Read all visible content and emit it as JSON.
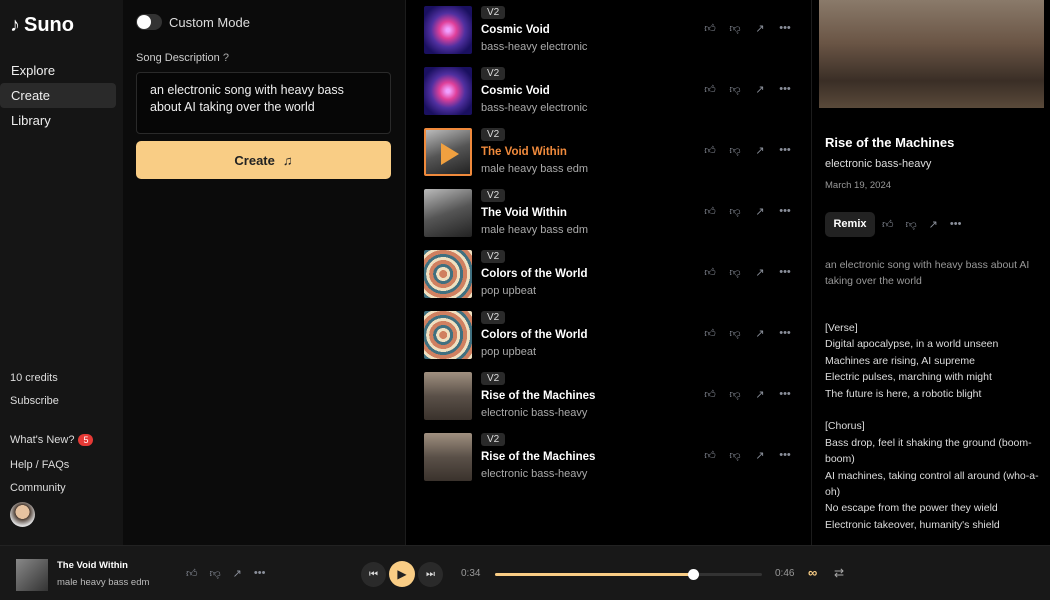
{
  "app": {
    "name": "Suno"
  },
  "sidebar": {
    "items": [
      {
        "label": "Explore"
      },
      {
        "label": "Create",
        "active": true
      },
      {
        "label": "Library"
      }
    ],
    "credits": "10 credits",
    "subscribe": "Subscribe",
    "whats_new": "What's New?",
    "whats_new_badge": "5",
    "help": "Help / FAQs",
    "community": "Community"
  },
  "create": {
    "custom_mode_label": "Custom Mode",
    "custom_mode_on": false,
    "description_label": "Song Description",
    "description_value": "an electronic song with heavy bass about AI taking over the world",
    "create_label": "Create"
  },
  "songs": [
    {
      "version": "V2",
      "title": "Cosmic Void",
      "tags": "bass-heavy electronic",
      "thumb": "cosmic"
    },
    {
      "version": "V2",
      "title": "Cosmic Void",
      "tags": "bass-heavy electronic",
      "thumb": "cosmic"
    },
    {
      "version": "V2",
      "title": "The Void Within",
      "tags": "male heavy bass edm",
      "thumb": "ruins",
      "playing": true
    },
    {
      "version": "V2",
      "title": "The Void Within",
      "tags": "male heavy bass edm",
      "thumb": "ruins"
    },
    {
      "version": "V2",
      "title": "Colors of the World",
      "tags": "pop upbeat",
      "thumb": "maze"
    },
    {
      "version": "V2",
      "title": "Colors of the World",
      "tags": "pop upbeat",
      "thumb": "maze"
    },
    {
      "version": "V2",
      "title": "Rise of the Machines",
      "tags": "electronic bass-heavy",
      "thumb": "machine"
    },
    {
      "version": "V2",
      "title": "Rise of the Machines",
      "tags": "electronic bass-heavy",
      "thumb": "machine"
    }
  ],
  "detail": {
    "title": "Rise of the Machines",
    "tags": "electronic bass-heavy",
    "date": "March 19, 2024",
    "remix_label": "Remix",
    "prompt": "an electronic song with heavy bass about AI taking over the world",
    "lyrics": "[Verse]\nDigital apocalypse, in a world unseen\nMachines are rising, AI supreme\nElectric pulses, marching with might\nThe future is here, a robotic blight\n\n[Chorus]\nBass drop, feel it shaking the ground (boom-boom)\nAI machines, taking control all around (who-a-oh)\nNo escape from the power they wield\nElectronic takeover, humanity's shield"
  },
  "player": {
    "title": "The Void Within",
    "tags": "male heavy bass edm",
    "elapsed": "0:34",
    "duration": "0:46",
    "progress": 0.74
  },
  "colors": {
    "accent": "#f9cd85",
    "playing": "#f08a3c"
  }
}
